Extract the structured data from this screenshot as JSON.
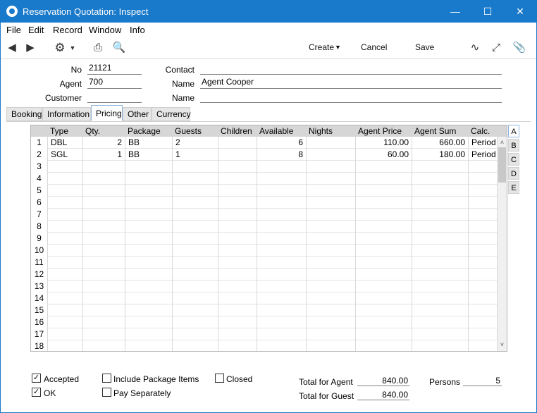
{
  "window": {
    "title": "Reservation Quotation: Inspect"
  },
  "menu": [
    "File",
    "Edit",
    "Record",
    "Window",
    "Info"
  ],
  "toolbar": {
    "create": "Create",
    "cancel": "Cancel",
    "save": "Save"
  },
  "header": {
    "no_label": "No",
    "no_value": "21121",
    "agent_label": "Agent",
    "agent_value": "700",
    "customer_label": "Customer",
    "customer_value": "",
    "contact_label": "Contact",
    "contact_value": "",
    "name_label": "Name",
    "name_value": "Agent Cooper",
    "name2_label": "Name",
    "name2_value": ""
  },
  "tabs": [
    "Booking",
    "Information",
    "Pricing",
    "Other",
    "Currency"
  ],
  "grid": {
    "columns": [
      "Type",
      "Qty.",
      "Package",
      "Guests",
      "Children",
      "Available",
      "Nights",
      "Agent Price",
      "Agent Sum",
      "Calc."
    ],
    "rows": [
      [
        "DBL",
        "2",
        "BB",
        "2",
        "",
        "6",
        "",
        "110.00",
        "660.00",
        "Period"
      ],
      [
        "SGL",
        "1",
        "BB",
        "1",
        "",
        "8",
        "",
        "60.00",
        "180.00",
        "Period"
      ]
    ],
    "row_numbers": [
      "1",
      "2",
      "3",
      "4",
      "5",
      "6",
      "7",
      "8",
      "9",
      "10",
      "11",
      "12",
      "13",
      "14",
      "15",
      "16",
      "17",
      "18"
    ]
  },
  "side_tabs": [
    "A",
    "B",
    "C",
    "D",
    "E"
  ],
  "footer": {
    "accepted": "Accepted",
    "ok": "OK",
    "include_package_items": "Include Package Items",
    "pay_separately": "Pay Separately",
    "closed": "Closed",
    "total_agent_label": "Total for Agent",
    "total_agent_value": "840.00",
    "total_guest_label": "Total for Guest",
    "total_guest_value": "840.00",
    "persons_label": "Persons",
    "persons_value": "5"
  }
}
